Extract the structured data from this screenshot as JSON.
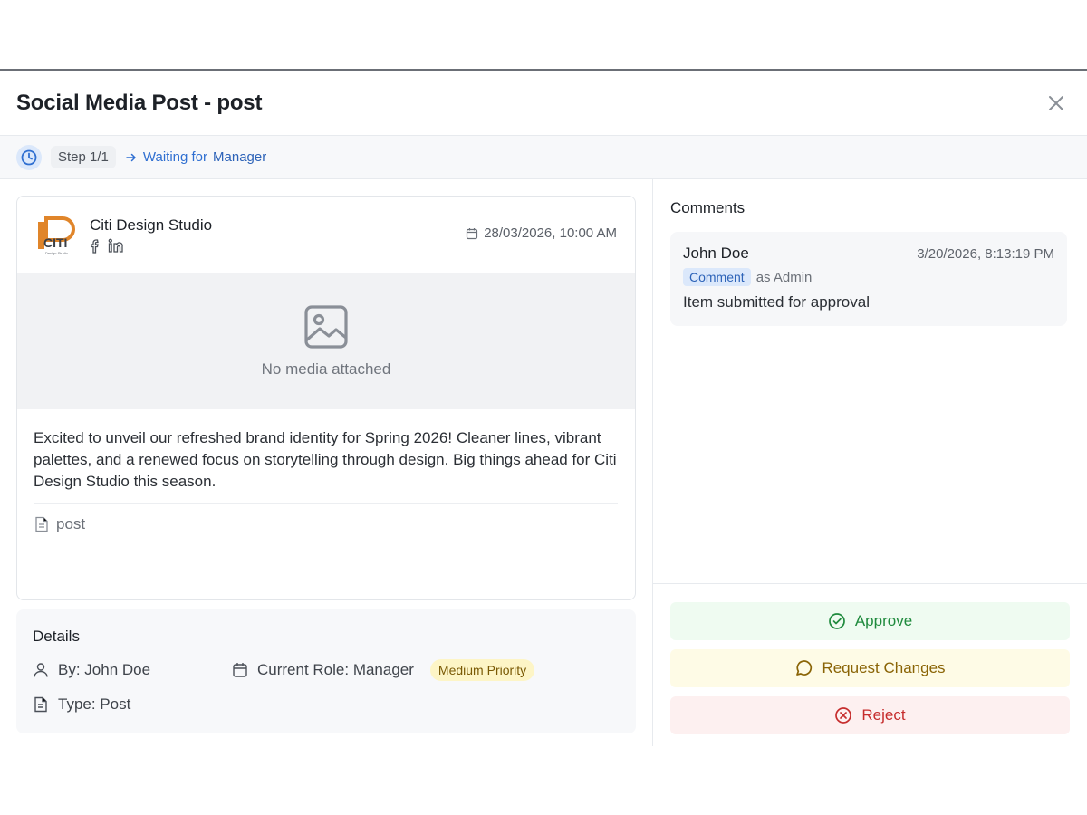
{
  "modal": {
    "title": "Social Media Post - post"
  },
  "workflow": {
    "step": "Step 1/1",
    "waiting_prefix": "Waiting for",
    "waiting_role": "Manager"
  },
  "post": {
    "brand_name": "Citi Design Studio",
    "logo_text": "CITI",
    "logo_subtext": "Design Studio",
    "networks": [
      "facebook-icon",
      "linkedin-icon"
    ],
    "scheduled": "28/03/2026, 10:00 AM",
    "media_placeholder": "No media attached",
    "caption": "Excited to unveil our refreshed brand identity for Spring 2026! Cleaner lines, vibrant palettes, and a renewed focus on storytelling through design. Big things ahead for Citi Design Studio this season.",
    "type_label": "post"
  },
  "details": {
    "title": "Details",
    "by": "By: John Doe",
    "role": "Current Role: Manager",
    "priority": "Medium Priority",
    "type": "Type: Post"
  },
  "comments": {
    "title": "Comments",
    "items": [
      {
        "author": "John Doe",
        "time": "3/20/2026, 8:13:19 PM",
        "badge": "Comment",
        "role": "as Admin",
        "text": "Item submitted for approval"
      }
    ]
  },
  "actions": {
    "approve": "Approve",
    "request_changes": "Request Changes",
    "reject": "Reject"
  },
  "colors": {
    "approve": "#1f8a3d",
    "changes": "#8a6406",
    "reject": "#c62d2d",
    "link": "#2f6fd1",
    "logo_orange": "#e0852a"
  }
}
